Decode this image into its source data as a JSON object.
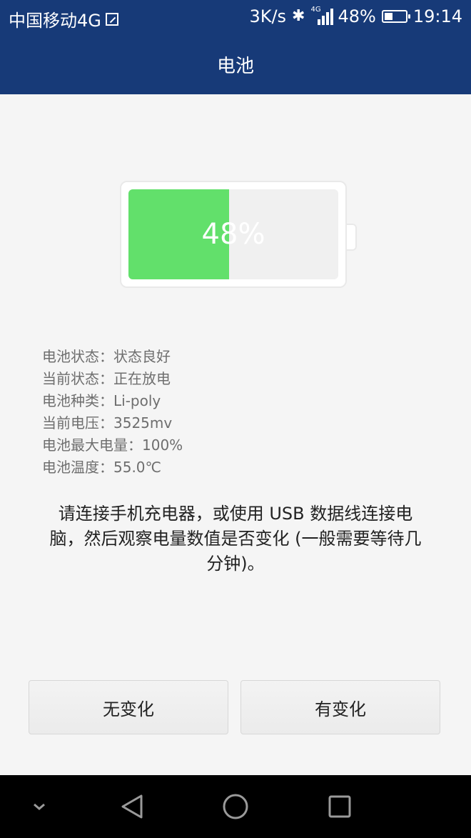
{
  "status_bar": {
    "carrier": "中国移动4G",
    "speed": "3K/s",
    "signal_label": "4G",
    "battery_percent": "48%",
    "time": "19:14",
    "icons": [
      "edit-icon",
      "bluetooth-icon",
      "signal-icon",
      "battery-icon"
    ]
  },
  "app_bar": {
    "title": "电池"
  },
  "battery_graphic": {
    "level": 0.48,
    "label": "48%",
    "fill_color": "#62e06b"
  },
  "info": [
    {
      "label": "电池状态：",
      "value": "状态良好"
    },
    {
      "label": "当前状态：",
      "value": "正在放电"
    },
    {
      "label": "电池种类：",
      "value": "Li-poly"
    },
    {
      "label": "当前电压：",
      "value": "3525mv"
    },
    {
      "label": "电池最大电量：",
      "value": "100%"
    },
    {
      "label": "电池温度：",
      "value": "55.0℃"
    }
  ],
  "instruction": "请连接手机充电器，或使用 USB 数据线连接电脑，然后观察电量数值是否变化 (一般需要等待几分钟)。",
  "buttons": {
    "no_change": "无变化",
    "changed": "有变化"
  },
  "nav_bar": {
    "icons": [
      "chevron-down-icon",
      "back-icon",
      "home-icon",
      "recents-icon"
    ]
  },
  "colors": {
    "primary": "#173a78",
    "battery_green": "#62e06b"
  }
}
